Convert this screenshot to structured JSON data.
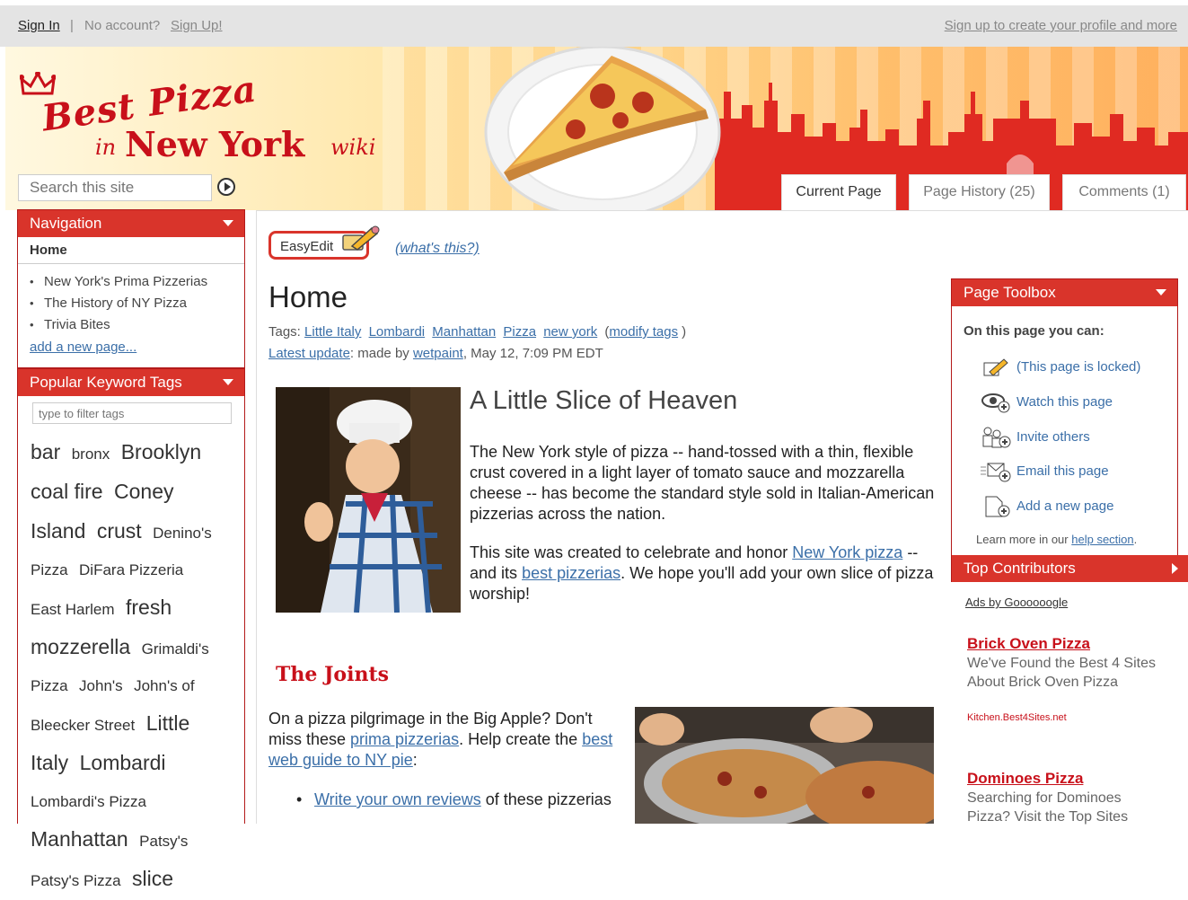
{
  "topbar": {
    "sign_in": "Sign In",
    "separator": "|",
    "no_account": "No account?",
    "sign_up": "Sign Up!",
    "create_profile": "Sign up to create your profile and more"
  },
  "logo": {
    "best_pizza": "Best Pizza",
    "in": "in",
    "new_york": "New York",
    "wiki": "wiki"
  },
  "search": {
    "placeholder": "Search this site"
  },
  "tabs": [
    {
      "label": "Current Page"
    },
    {
      "label": "Page History (25)"
    },
    {
      "label": "Comments (1)"
    }
  ],
  "sidebar": {
    "navigation": {
      "heading": "Navigation",
      "home": "Home",
      "items": [
        {
          "label": "New York's Prima Pizzerias"
        },
        {
          "label": "The History of NY Pizza"
        },
        {
          "label": "Trivia Bites"
        }
      ],
      "add_page": "add a new page..."
    },
    "tags": {
      "heading": "Popular Keyword Tags",
      "filter_placeholder": "type to filter tags",
      "cloud": [
        {
          "tag": "bar"
        },
        {
          "tag": "bronx"
        },
        {
          "tag": "Brooklyn"
        },
        {
          "tag": "coal fire"
        },
        {
          "tag": "Coney"
        },
        {
          "tag": "Island"
        },
        {
          "tag": "crust"
        },
        {
          "tag": "Denino's"
        },
        {
          "tag": "Pizza"
        },
        {
          "tag": "DiFara Pizzeria"
        },
        {
          "tag": "East Harlem"
        },
        {
          "tag": "fresh"
        },
        {
          "tag": "mozzerella"
        },
        {
          "tag": "Grimaldi's"
        },
        {
          "tag": "Pizza"
        },
        {
          "tag": "John's"
        },
        {
          "tag": "John's of"
        },
        {
          "tag": "Bleecker Street"
        },
        {
          "tag": "Little"
        },
        {
          "tag": "Italy"
        },
        {
          "tag": "Lombardi"
        },
        {
          "tag": "Lombardi's Pizza"
        },
        {
          "tag": "Manhattan"
        },
        {
          "tag": "Patsy's"
        },
        {
          "tag": "Patsy's Pizza"
        },
        {
          "tag": "slice"
        }
      ]
    }
  },
  "page": {
    "easyedit": "EasyEdit",
    "whats_this": "(what's this?)",
    "title": "Home",
    "tags_label": "Tags:",
    "tags": [
      "Little Italy",
      "Lombardi",
      "Manhattan",
      "Pizza",
      "new york"
    ],
    "modify_tags": "modify tags",
    "latest_update": "Latest update",
    "made_by": ": made by",
    "author": "wetpaint",
    "date": ", May 12, 7:09 PM EDT",
    "heading1": "A Little Slice of Heaven",
    "para1": "The New York style of pizza -- hand-tossed with a thin, flexible crust covered in a light layer of tomato sauce and mozzarella cheese -- has become the standard style sold in Italian-American pizzerias across the nation.",
    "para2_a": "This site was created to celebrate and honor",
    "para2_link1": "New York pizza",
    "para2_b": "-- and its",
    "para2_link2": "best pizzerias",
    "para2_c": ". We hope you'll add your own slice of pizza worship!",
    "heading2": "The Joints",
    "para3_a": "On a pizza pilgrimage in the Big Apple? Don't miss these",
    "para3_link1": "prima pizzerias",
    "para3_b": ". Help create the",
    "para3_link2": "best web guide to NY pie",
    "para3_c": ":",
    "bullet_link": "Write your own reviews",
    "bullet_text": "of these pizzerias"
  },
  "toolbox": {
    "heading": "Page Toolbox",
    "on_this_page": "On this page you can:",
    "items": [
      {
        "label": "(This page is locked)",
        "icon": "lock-edit-icon"
      },
      {
        "label": "Watch this page",
        "icon": "eye-plus-icon"
      },
      {
        "label": "Invite others",
        "icon": "people-plus-icon"
      },
      {
        "label": "Email this page",
        "icon": "envelope-plus-icon"
      },
      {
        "label": "Add a new page",
        "icon": "page-plus-icon"
      }
    ],
    "learn_more": "Learn more in our",
    "help_section": "help section",
    "top_contributors": "Top Contributors"
  },
  "ads": {
    "ads_by": "Ads by Goooooogle",
    "items": [
      {
        "title": "Brick Oven Pizza",
        "body": "We've Found the Best 4 Sites About Brick Oven Pizza",
        "url": "Kitchen.Best4Sites.net"
      },
      {
        "title": "Dominoes Pizza",
        "body": "Searching for Dominoes Pizza? Visit the Top Sites"
      }
    ]
  },
  "colors": {
    "accent_red": "#d9342b",
    "link_blue": "#3b6fa8",
    "brand_red": "#c8101a"
  }
}
